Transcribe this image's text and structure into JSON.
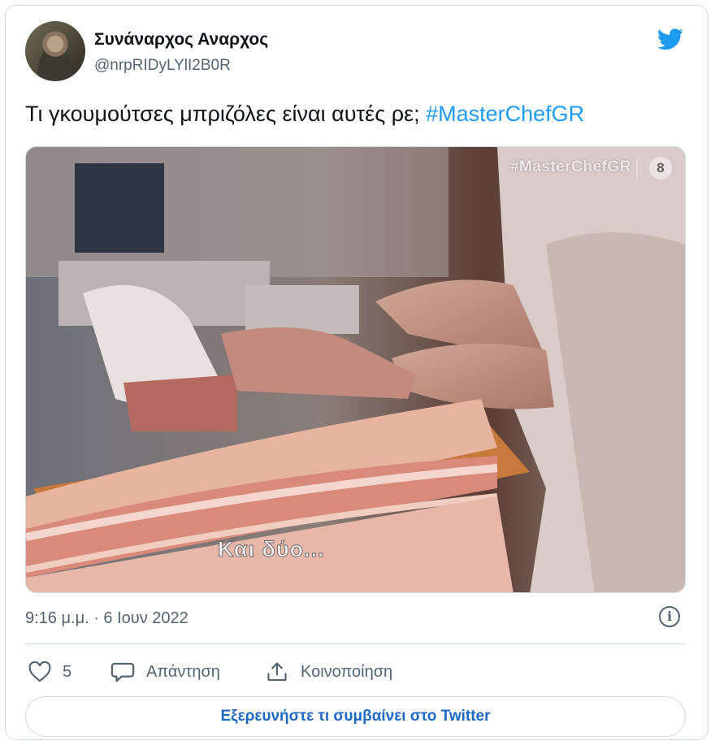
{
  "author": {
    "name": "Συνάναρχος Αναρχος",
    "handle": "@nrpRIDyLYlI2B0R",
    "avatar_icon": "avatar-photo"
  },
  "brand_icon": "twitter-bird-icon",
  "tweet": {
    "text": "Τι γκουμούτσες μπριζόλες είναι αυτές ρε; ",
    "hashtag": "#MasterChefGR"
  },
  "media": {
    "watermark": "#MasterChefGR",
    "channel_number": "8",
    "subtitle": "Και δύο..."
  },
  "timestamp": "9:16 μ.μ. · 6 Ιουν 2022",
  "actions": {
    "like_count": "5",
    "reply_label": "Απάντηση",
    "share_label": "Κοινοποίηση"
  },
  "cta_label": "Εξερευνήστε τι συμβαίνει στο Twitter",
  "colors": {
    "accent": "#1d9bf0",
    "text": "#0f1419",
    "muted": "#536471",
    "border": "#cfd9de"
  }
}
